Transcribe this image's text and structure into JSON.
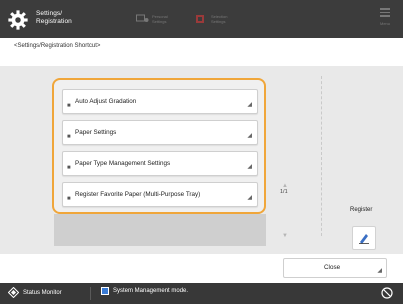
{
  "header": {
    "title_line1": "Settings/",
    "title_line2": "Registration",
    "btn1_line1": "Personal",
    "btn1_line2": "Settings",
    "btn2_line1": "Selection",
    "btn2_line2": "Settings",
    "menu_label": "Menu"
  },
  "breadcrumb": "<Settings/Registration Shortcut>",
  "list": {
    "items": [
      {
        "label": "Auto Adjust Gradation"
      },
      {
        "label": "Paper Settings"
      },
      {
        "label": "Paper Type Management Settings"
      },
      {
        "label": "Register Favorite Paper (Multi-Purpose Tray)"
      }
    ],
    "page_indicator": "1/1"
  },
  "register": {
    "label": "Register"
  },
  "close_label": "Close",
  "statusbar": {
    "status_monitor": "Status Monitor",
    "system_management": "System Management mode."
  },
  "colors": {
    "highlight": "#f0a63a",
    "titlebar": "#3c3c3c",
    "statusbar": "#383838"
  }
}
